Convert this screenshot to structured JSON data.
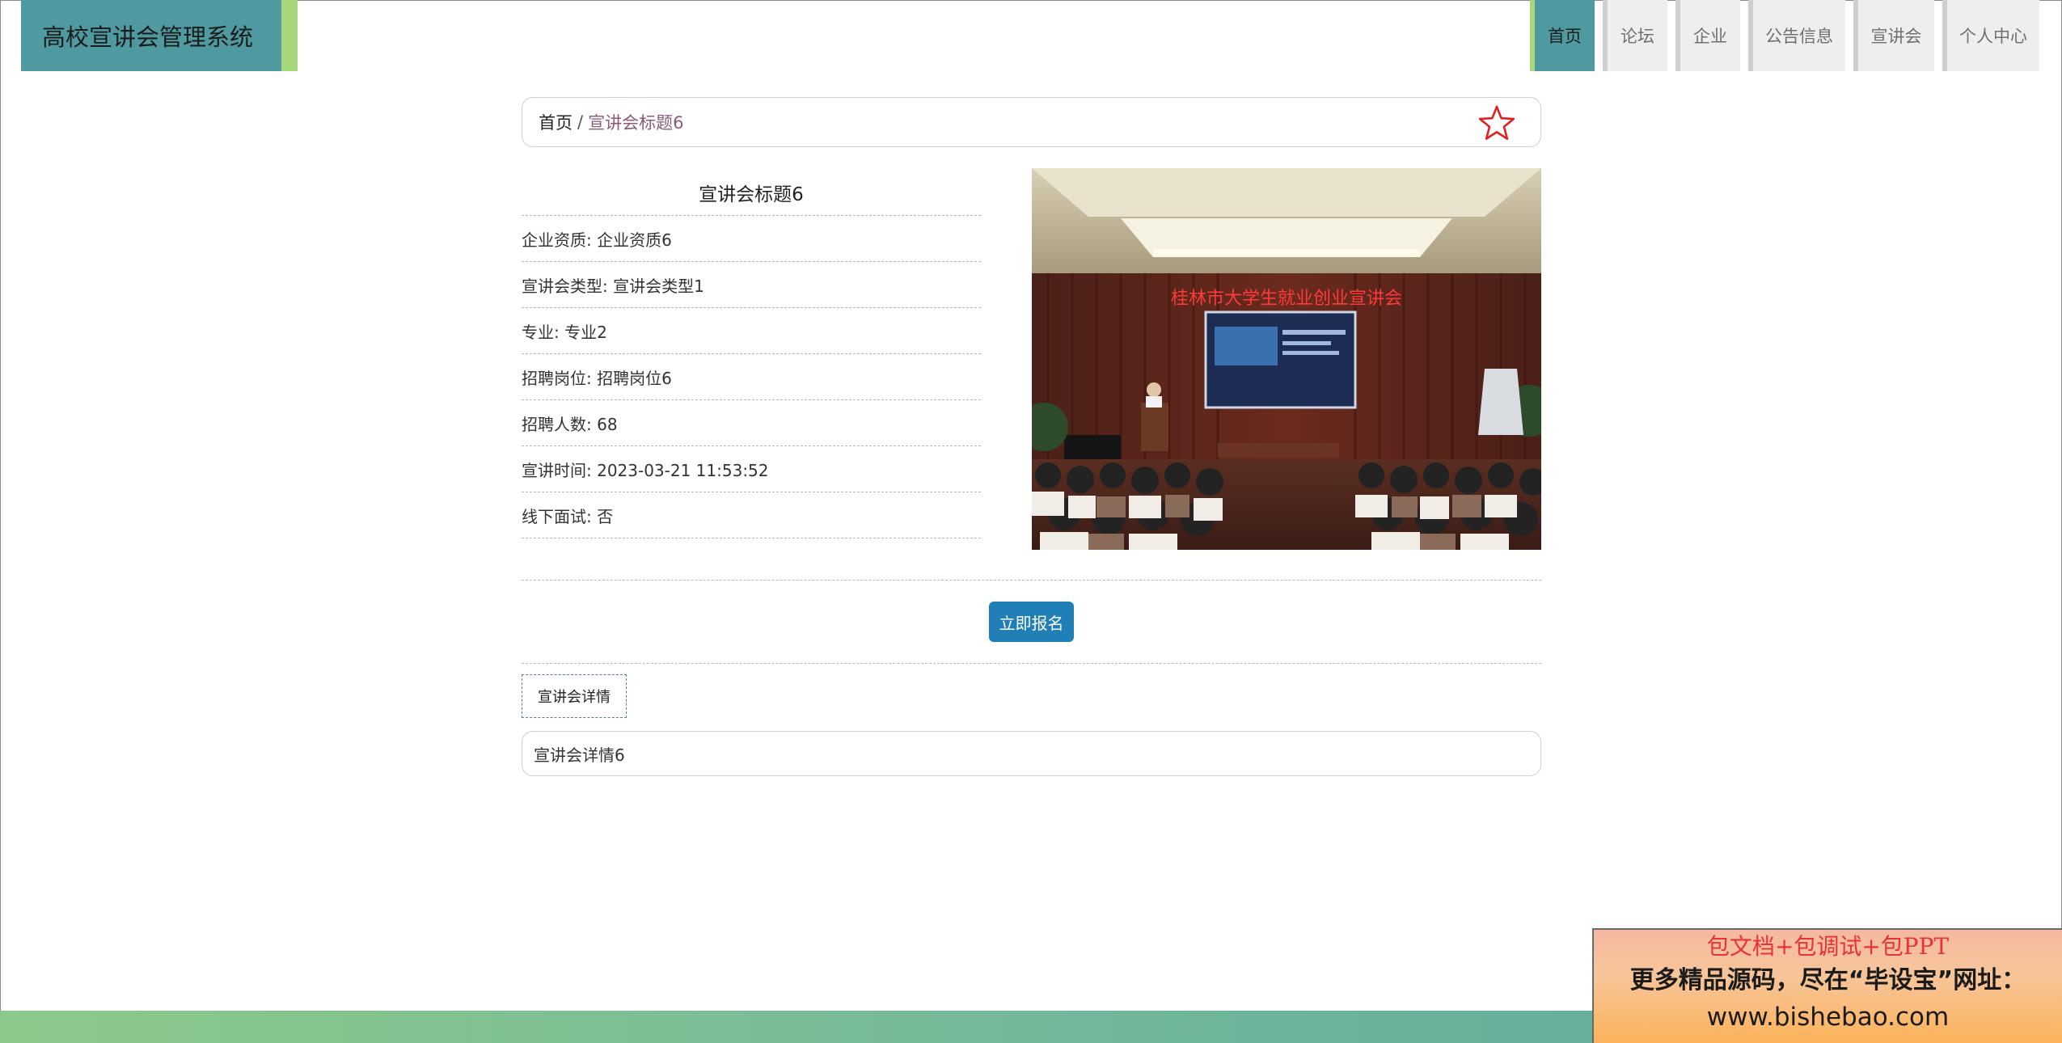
{
  "app": {
    "title": "高校宣讲会管理系统"
  },
  "nav": {
    "items": [
      {
        "label": "首页",
        "active": true
      },
      {
        "label": "论坛",
        "active": false
      },
      {
        "label": "企业",
        "active": false
      },
      {
        "label": "公告信息",
        "active": false
      },
      {
        "label": "宣讲会",
        "active": false
      },
      {
        "label": "个人中心",
        "active": false
      }
    ]
  },
  "breadcrumb": {
    "home": "首页",
    "separator": "/",
    "current": "宣讲会标题6",
    "favorite_icon": "star-outline-icon"
  },
  "info": {
    "title": "宣讲会标题6",
    "rows": [
      "企业资质: 企业资质6",
      "宣讲会类型: 宣讲会类型1",
      "专业: 专业2",
      "招聘岗位: 招聘岗位6",
      "招聘人数: 68",
      "宣讲时间: 2023-03-21 11:53:52",
      "线下面试: 否"
    ]
  },
  "photo": {
    "banner_text": "桂林市大学生就业创业宣讲会"
  },
  "actions": {
    "signup_label": "立即报名"
  },
  "detail": {
    "tab_label": "宣讲会详情",
    "content": "宣讲会详情6"
  },
  "ad": {
    "line1": "包文档+包调试+包PPT",
    "line2": "更多精品源码，尽在“毕设宝”网址：",
    "line3": "www.bishebao.com"
  },
  "colors": {
    "brand": "#4f9aa1",
    "accent_green": "#a6d77a",
    "button": "#1f7fb6",
    "star": "#e02020",
    "crumb_current": "#8a5a7a"
  }
}
